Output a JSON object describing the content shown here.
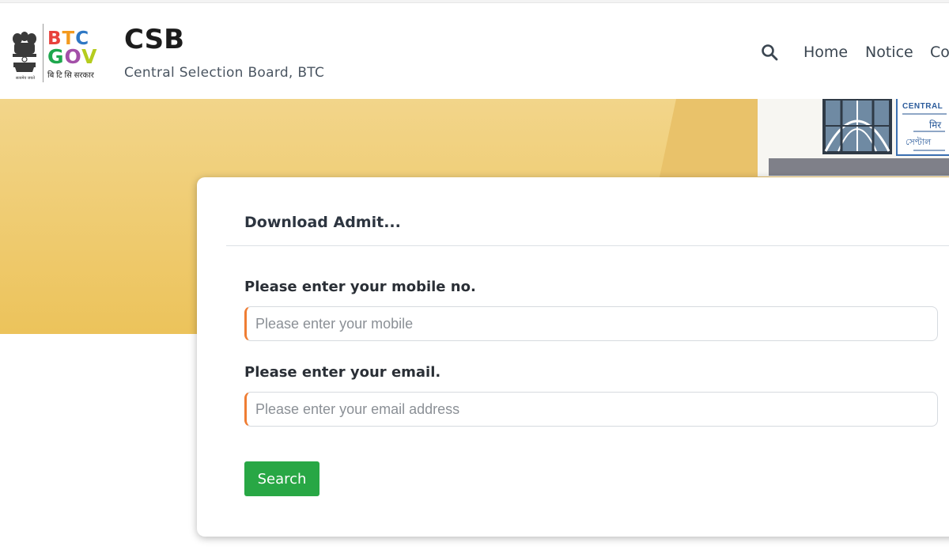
{
  "header": {
    "logo": {
      "btc_letters": [
        "B",
        "T",
        "C"
      ],
      "gov_letters": [
        "G",
        "O",
        "V"
      ],
      "subtitle": "बि टि सि सरकार",
      "emblem_caption": "सत्यमेव जयते",
      "colors": {
        "red": "#e8413c",
        "orange": "#f39a1e",
        "blue": "#2f78c4",
        "green": "#1ea74d",
        "purple": "#a34fa8",
        "lime": "#b5cc1e"
      }
    },
    "title": "CSB",
    "subtitle": "Central Selection Board, BTC"
  },
  "nav": {
    "search_icon": "search-icon",
    "items": [
      {
        "label": "Home"
      },
      {
        "label": "Notice"
      },
      {
        "label": "Co"
      }
    ]
  },
  "hero": {
    "sign_title": "CENTRAL",
    "sign_hindi": "मिर",
    "sign_bengali": "সেণ্টাল"
  },
  "form": {
    "title": "Download Admit...",
    "mobile": {
      "label": "Please enter your mobile no.",
      "placeholder": "Please enter your mobile",
      "value": ""
    },
    "email": {
      "label": "Please enter your email.",
      "placeholder": "Please enter your email address",
      "value": ""
    },
    "search_label": "Search"
  },
  "colors": {
    "accent_orange": "#ef7d33",
    "button_green": "#28a745",
    "hero_yellow": "#ecc35b"
  }
}
